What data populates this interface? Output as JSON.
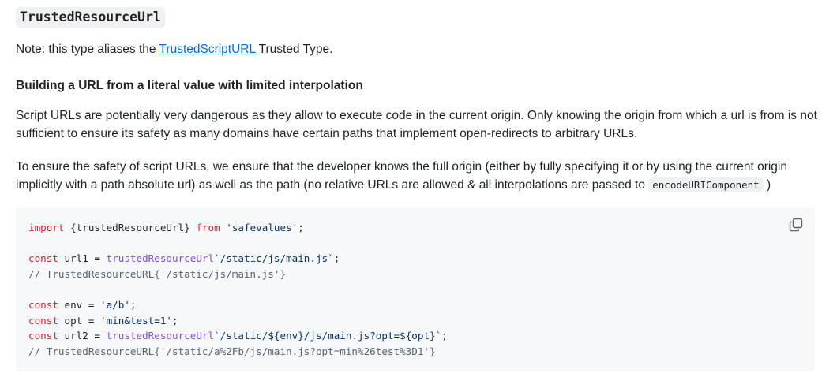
{
  "heading": {
    "title": "TrustedResourceUrl"
  },
  "note": {
    "prefix": "Note: this type aliases the ",
    "link_text": "TrustedScriptURL",
    "suffix": " Trusted Type."
  },
  "section": {
    "heading": "Building a URL from a literal value with limited interpolation",
    "paragraph1": "Script URLs are potentially very dangerous as they allow to execute code in the current origin. Only knowing the origin from which a url is from is not sufficient to ensure its safety as many domains have certain paths that implement open-redirects to arbitrary URLs.",
    "paragraph2_text": "To ensure the safety of script URLs, we ensure that the developer knows the full origin (either by fully specifying it or by using the current origin implicitly with a path absolute url) as well as the path (no relative URLs are allowed & all interpolations are passed to ",
    "paragraph2_code": "encodeURIComponent",
    "paragraph2_end": " )"
  },
  "code": {
    "line1_kw1": "import",
    "line1_mid": " {trustedResourceUrl} ",
    "line1_kw2": "from",
    "line1_sp": " ",
    "line1_str": "'safevalues'",
    "line1_end": ";",
    "line3_kw": "const",
    "line3_var": " url1 = ",
    "line3_fn": "trustedResourceUrl",
    "line3_str": "`/static/js/main.js`",
    "line3_end": ";",
    "line4_cm": "// TrustedResourceURL{'/static/js/main.js'}",
    "line6_kw": "const",
    "line6_var": " env = ",
    "line6_str": "'a/b'",
    "line6_end": ";",
    "line7_kw": "const",
    "line7_var": " opt = ",
    "line7_str": "'min&test=1'",
    "line7_end": ";",
    "line8_kw": "const",
    "line8_var": " url2 = ",
    "line8_fn": "trustedResourceUrl",
    "line8_str": "`/static/${env}/js/main.js?opt=${opt}`",
    "line8_end": ";",
    "line9_cm": "// TrustedResourceURL{'/static/a%2Fb/js/main.js?opt=min%26test%3D1'}"
  },
  "icons": {
    "copy": "copy-icon"
  }
}
